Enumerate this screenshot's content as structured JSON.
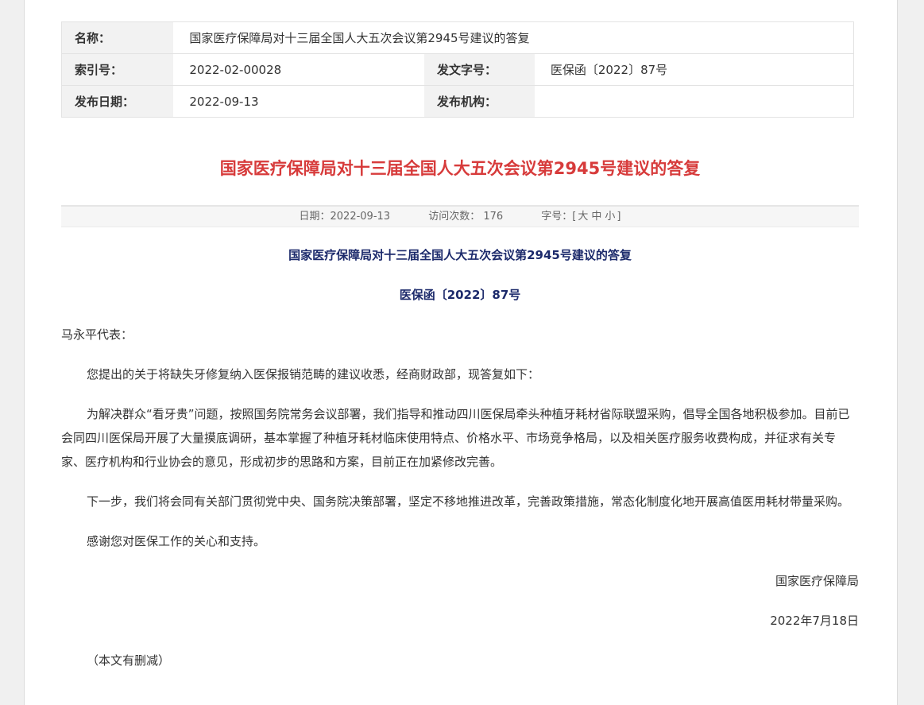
{
  "meta": {
    "name_label": "名称：",
    "name_value": "国家医疗保障局对十三届全国人大五次会议第2945号建议的答复",
    "index_label": "索引号：",
    "index_value": "2022-02-00028",
    "doc_no_label": "发文字号：",
    "doc_no_value": "医保函〔2022〕87号",
    "date_label": "发布日期：",
    "date_value": "2022-09-13",
    "org_label": "发布机构：",
    "org_value": ""
  },
  "title": "国家医疗保障局对十三届全国人大五次会议第2945号建议的答复",
  "info_bar": {
    "date": "日期：2022-09-13",
    "visits": "访问次数： 176",
    "font_label": "字号：[",
    "font_large": "大",
    "font_medium": "中",
    "font_small": "小",
    "font_close": "]"
  },
  "article": {
    "subtitle": "国家医疗保障局对十三届全国人大五次会议第2945号建议的答复",
    "doc_number": "医保函〔2022〕87号",
    "salutation": "马永平代表：",
    "p1": "您提出的关于将缺失牙修复纳入医保报销范畴的建议收悉，经商财政部，现答复如下：",
    "p2": "为解决群众“看牙贵”问题，按照国务院常务会议部署，我们指导和推动四川医保局牵头种植牙耗材省际联盟采购，倡导全国各地积极参加。目前已会同四川医保局开展了大量摸底调研，基本掌握了种植牙耗材临床使用特点、价格水平、市场竞争格局，以及相关医疗服务收费构成，并征求有关专家、医疗机构和行业协会的意见，形成初步的思路和方案，目前正在加紧修改完善。",
    "p3": "下一步，我们将会同有关部门贯彻党中央、国务院决策部署，坚定不移地推进改革，完善政策措施，常态化制度化地开展高值医用耗材带量采购。",
    "p4": "感谢您对医保工作的关心和支持。",
    "signature": "国家医疗保障局",
    "sign_date": "2022年7月18日",
    "note": "（本文有删减）"
  }
}
